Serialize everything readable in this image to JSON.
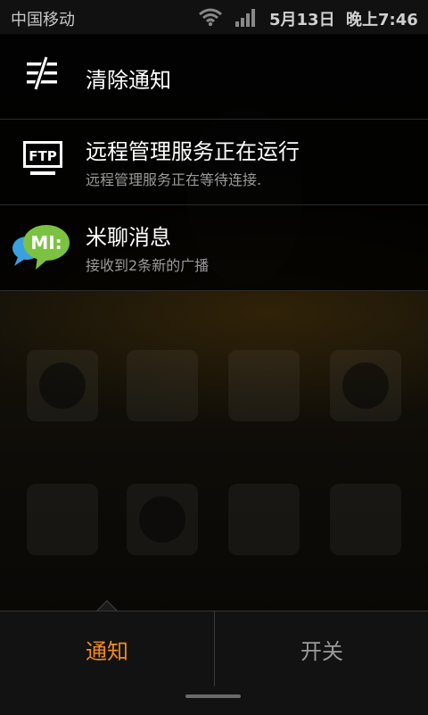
{
  "status_bar": {
    "carrier": "中国移动",
    "date": "5月13日",
    "time": "晚上7:46"
  },
  "notifications": [
    {
      "title": "清除通知",
      "subtitle": "",
      "icon": "clear-notifications-icon"
    },
    {
      "title": "远程管理服务正在运行",
      "subtitle": "远程管理服务正在等待连接.",
      "icon": "ftp-icon"
    },
    {
      "title": "米聊消息",
      "subtitle": "接收到2条新的广播",
      "icon": "miliao-icon"
    }
  ],
  "tabs": {
    "notifications_label": "通知",
    "switches_label": "开关"
  },
  "colors": {
    "active_tab": "#f08a1c",
    "inactive_tab": "#9a9a9a",
    "miliao_green": "#7cc242",
    "miliao_blue": "#3aa0e0"
  }
}
